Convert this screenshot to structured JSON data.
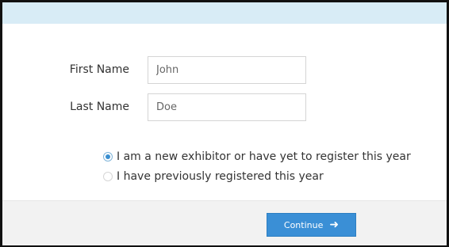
{
  "form": {
    "first_name_label": "First Name",
    "first_name_value": "John",
    "last_name_label": "Last Name",
    "last_name_value": "Doe"
  },
  "options": {
    "new_exhibitor_label": "I am a new exhibitor or have yet to register this year",
    "new_exhibitor_checked": true,
    "previous_label": "I have previously registered this year",
    "previous_checked": false
  },
  "footer": {
    "continue_label": "Continue",
    "continue_icon": "arrow-right-icon"
  },
  "colors": {
    "header_band": "#d8ecf6",
    "accent": "#3a8fd6",
    "footer_bg": "#f2f2f2"
  }
}
